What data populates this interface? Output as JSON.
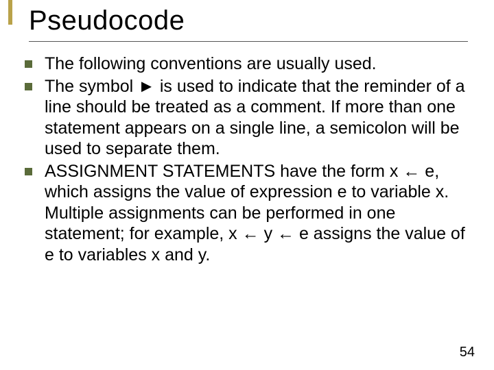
{
  "title": "Pseudocode",
  "bullets": [
    "The following conventions are usually used.",
    "The symbol ► is used to indicate that the reminder of a line should be treated as a comment. If more than one statement appears on a single line, a semicolon will be used to separate them.",
    "ASSIGNMENT STATEMENTS have the form  x ← e, which assigns the value of expression e to variable x. Multiple assignments can be performed in one statement; for example, x ← y ← e   assigns the value of e to variables x and y."
  ],
  "page_number": "54",
  "colors": {
    "accent": "#b9a24a",
    "bullet": "#5a6b3a"
  }
}
